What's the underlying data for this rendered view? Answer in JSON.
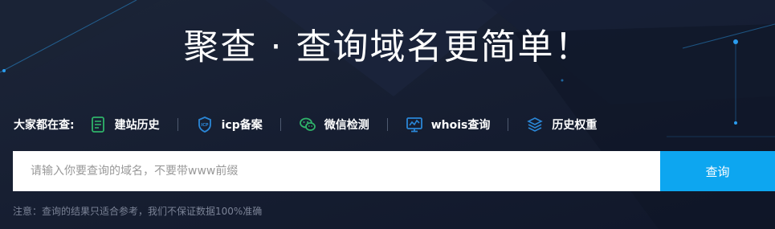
{
  "hero": {
    "title": "聚查 · 查询域名更简单！"
  },
  "tags": {
    "label": "大家都在查:",
    "items": [
      {
        "label": "建站历史",
        "icon": "history-doc-icon",
        "color": "#2fb36a"
      },
      {
        "label": "icp备案",
        "icon": "icp-shield-icon",
        "color": "#2a86d6"
      },
      {
        "label": "微信检测",
        "icon": "wechat-icon",
        "color": "#2fb36a"
      },
      {
        "label": "whois查询",
        "icon": "monitor-chart-icon",
        "color": "#2a86d6"
      },
      {
        "label": "历史权重",
        "icon": "layers-icon",
        "color": "#2a86d6"
      }
    ]
  },
  "search": {
    "placeholder": "请输入你要查询的域名，不要带www前缀",
    "button_label": "查询",
    "button_color": "#0da6f0"
  },
  "note": "注意：查询的结果只适合参考，我们不保证数据100%准确"
}
